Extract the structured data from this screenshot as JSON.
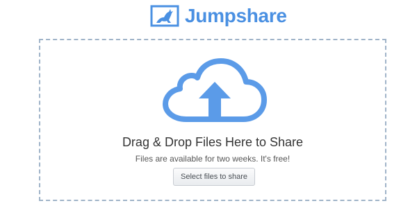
{
  "brand": {
    "name": "Jumpshare",
    "logo_icon": "kangaroo-logo-icon",
    "color": "#4a90e2"
  },
  "dropzone": {
    "cloud_icon": "cloud-upload-icon",
    "headline": "Drag & Drop Files Here to Share",
    "subline": "Files are available for two weeks. It's free!",
    "button_label": "Select files to share",
    "border_color": "#9fb3c8",
    "accent_color": "#5b9be8"
  }
}
